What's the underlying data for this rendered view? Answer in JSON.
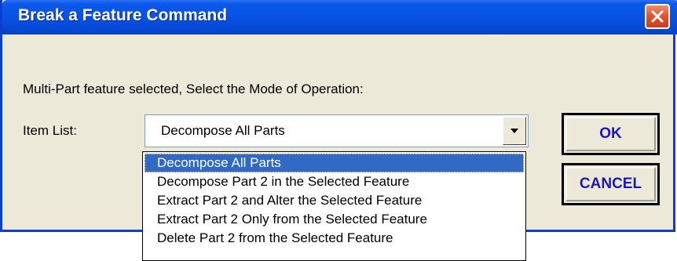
{
  "window": {
    "title": "Break a Feature Command",
    "close_icon": "close-icon"
  },
  "prompt": "Multi-Part feature selected, Select the Mode of Operation:",
  "item_list": {
    "label": "Item List:",
    "selected_value": "Decompose All Parts",
    "dropdown_icon": "chevron-down-icon",
    "options": [
      "Decompose All Parts",
      "Decompose Part 2 in the Selected Feature",
      "Extract Part 2 and Alter the Selected Feature",
      "Extract Part 2 Only from the Selected Feature",
      "Delete Part 2 from the Selected Feature"
    ],
    "highlighted_index": 0
  },
  "buttons": {
    "ok_label": "OK",
    "cancel_label": "CANCEL"
  },
  "colors": {
    "titlebar": "#0752e4",
    "selection": "#316ac5",
    "button_text": "#1a1ab4",
    "close_button": "#e2512f"
  }
}
